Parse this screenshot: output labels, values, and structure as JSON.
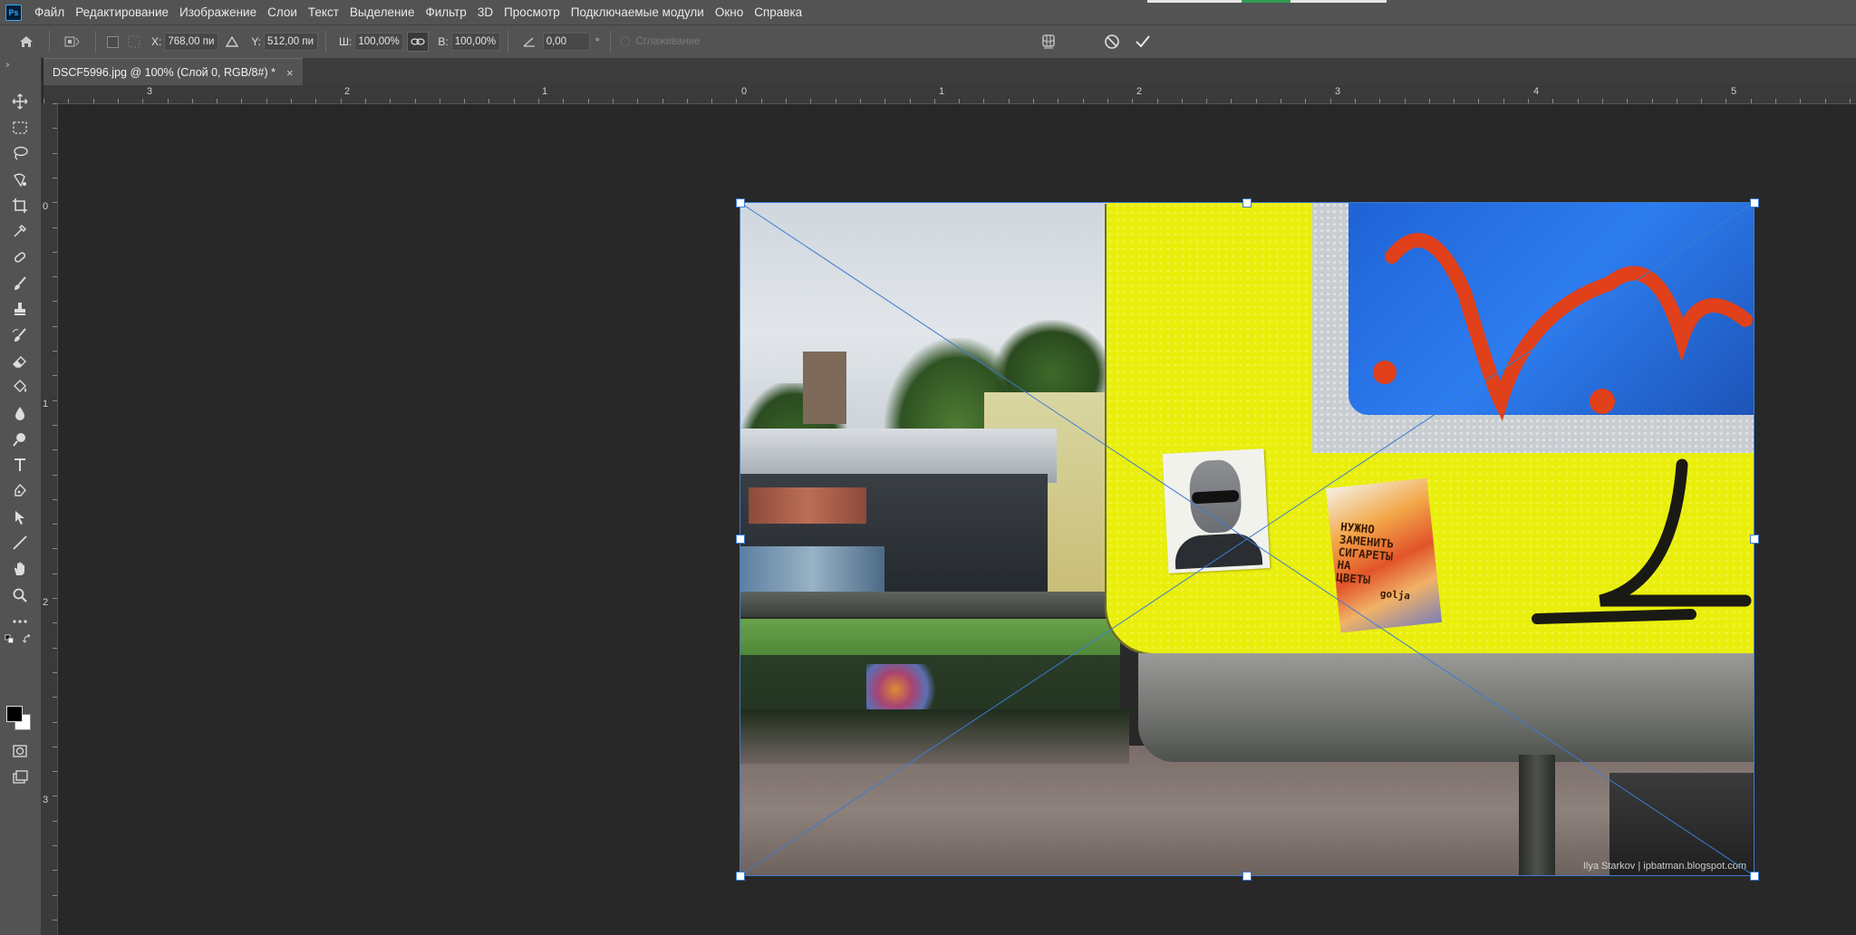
{
  "menu": {
    "logo": "Ps",
    "items": [
      "Файл",
      "Редактирование",
      "Изображение",
      "Слои",
      "Текст",
      "Выделение",
      "Фильтр",
      "3D",
      "Просмотр",
      "Подключаемые модули",
      "Окно",
      "Справка"
    ]
  },
  "options": {
    "x_label": "X:",
    "x_value": "768,00 пи",
    "y_label": "Y:",
    "y_value": "512,00 пи",
    "w_label": "Ш:",
    "w_value": "100,00%",
    "h_label": "В:",
    "h_value": "100,00%",
    "angle_value": "0,00",
    "degree": "°",
    "antialias_label": "Сглаживание"
  },
  "document": {
    "tab_title": "DSCF5996.jpg @ 100% (Слой 0, RGB/8#) *",
    "close": "×"
  },
  "rulers": {
    "horizontal": [
      "3",
      "2",
      "1",
      "0",
      "1",
      "2",
      "3",
      "4",
      "5"
    ],
    "vertical": [
      "0",
      "1",
      "2",
      "3"
    ]
  },
  "photo": {
    "sticker_lines": [
      "НУЖНО",
      "ЗАМЕНИТЬ",
      "СИГАРЕТЫ",
      "НА",
      "ЦВЕТЫ"
    ],
    "sticker_signature": "golja",
    "watermark": "Ilya Starkov | ipbatman.blogspot.com"
  },
  "colors": {
    "accent": "#31a8ff",
    "transform_line": "#3c7cd2",
    "sign_yellow": "#e9ef0a",
    "sign_blue": "#1f63d6"
  }
}
